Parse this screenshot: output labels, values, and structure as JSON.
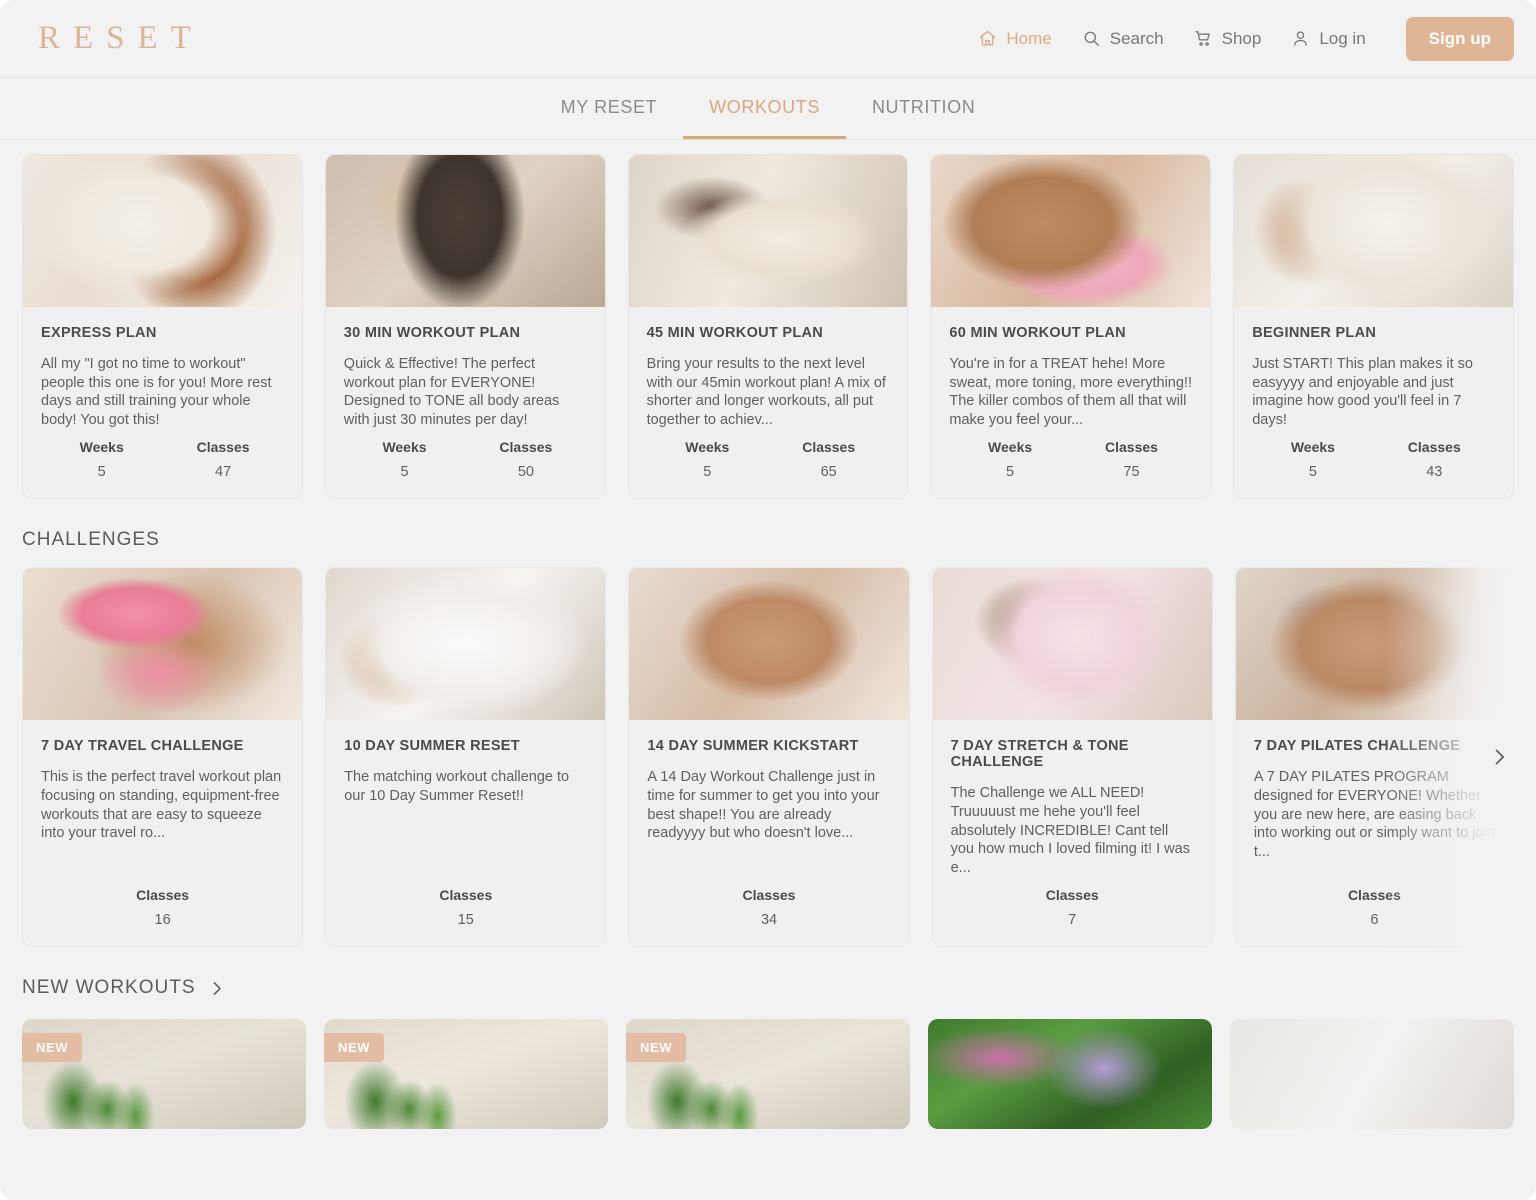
{
  "brand": {
    "logo": "RESET"
  },
  "nav": {
    "items": [
      {
        "label": "Home",
        "icon": "home-icon",
        "active": true
      },
      {
        "label": "Search",
        "icon": "search-icon",
        "active": false
      },
      {
        "label": "Shop",
        "icon": "cart-icon",
        "active": false
      },
      {
        "label": "Log in",
        "icon": "user-icon",
        "active": false
      }
    ],
    "signup_label": "Sign up"
  },
  "tabs": [
    {
      "label": "MY RESET",
      "active": false
    },
    {
      "label": "WORKOUTS",
      "active": true
    },
    {
      "label": "NUTRITION",
      "active": false
    }
  ],
  "plans": {
    "cards": [
      {
        "title": "EXPRESS PLAN",
        "desc": "All my \"I got no time to workout\" people this one is for you! More rest days and still training your whole body! You got this!",
        "weeks_label": "Weeks",
        "weeks": "5",
        "classes_label": "Classes",
        "classes": "47"
      },
      {
        "title": "30 MIN WORKOUT PLAN",
        "desc": "Quick & Effective! The perfect workout plan for EVERYONE! Designed to TONE all body areas with just 30 minutes per day!",
        "weeks_label": "Weeks",
        "weeks": "5",
        "classes_label": "Classes",
        "classes": "50"
      },
      {
        "title": "45 MIN WORKOUT PLAN",
        "desc": "Bring your results to the next level with our 45min workout plan! A mix of shorter and longer workouts, all put together to achiev...",
        "weeks_label": "Weeks",
        "weeks": "5",
        "classes_label": "Classes",
        "classes": "65"
      },
      {
        "title": "60 MIN WORKOUT PLAN",
        "desc": "You're in for a TREAT hehe! More sweat, more toning, more everything!! The killer combos of them all that will make you feel your...",
        "weeks_label": "Weeks",
        "weeks": "5",
        "classes_label": "Classes",
        "classes": "75"
      },
      {
        "title": "BEGINNER PLAN",
        "desc": "Just START! This plan makes it so easyyyy and enjoyable and just imagine how good you'll feel in 7 days!",
        "weeks_label": "Weeks",
        "weeks": "5",
        "classes_label": "Classes",
        "classes": "43"
      }
    ]
  },
  "challenges": {
    "section_title": "CHALLENGES",
    "cards": [
      {
        "title": "7 DAY TRAVEL CHALLENGE",
        "desc": "This is the perfect travel workout plan focusing on standing, equipment-free workouts that are easy to squeeze into your travel ro...",
        "classes_label": "Classes",
        "classes": "16"
      },
      {
        "title": "10 DAY SUMMER RESET",
        "desc": "The matching workout challenge to our 10 Day Summer Reset!!",
        "classes_label": "Classes",
        "classes": "15"
      },
      {
        "title": "14 DAY SUMMER KICKSTART",
        "desc": "A 14 Day Workout Challenge just in time for summer to get you into your best shape!! You are already readyyyy but who doesn't love...",
        "classes_label": "Classes",
        "classes": "34"
      },
      {
        "title": "7 DAY STRETCH & TONE CHALLENGE",
        "desc": "The Challenge we ALL NEED! Truuuuust me hehe you'll feel absolutely INCREDIBLE! Cant tell you how much I loved filming it! I was e...",
        "classes_label": "Classes",
        "classes": "7"
      },
      {
        "title": "7 DAY PILATES CHALLENGE",
        "desc": "A 7 DAY PILATES PROGRAM designed for EVERYONE! Whether you are new here, are easing back into working out or simply want to join t...",
        "classes_label": "Classes",
        "classes": "6"
      }
    ]
  },
  "new_workouts": {
    "section_title": "NEW WORKOUTS",
    "thumbs": [
      {
        "badge": "NEW"
      },
      {
        "badge": "NEW"
      },
      {
        "badge": "NEW"
      },
      {
        "badge": ""
      },
      {
        "badge": ""
      }
    ]
  },
  "colors": {
    "accent": "#dcab86",
    "signup_bg": "#dfb695",
    "badge_bg": "#e2bda4",
    "page_bg": "#f2f2f2",
    "card_bg": "#f1f0f0"
  }
}
